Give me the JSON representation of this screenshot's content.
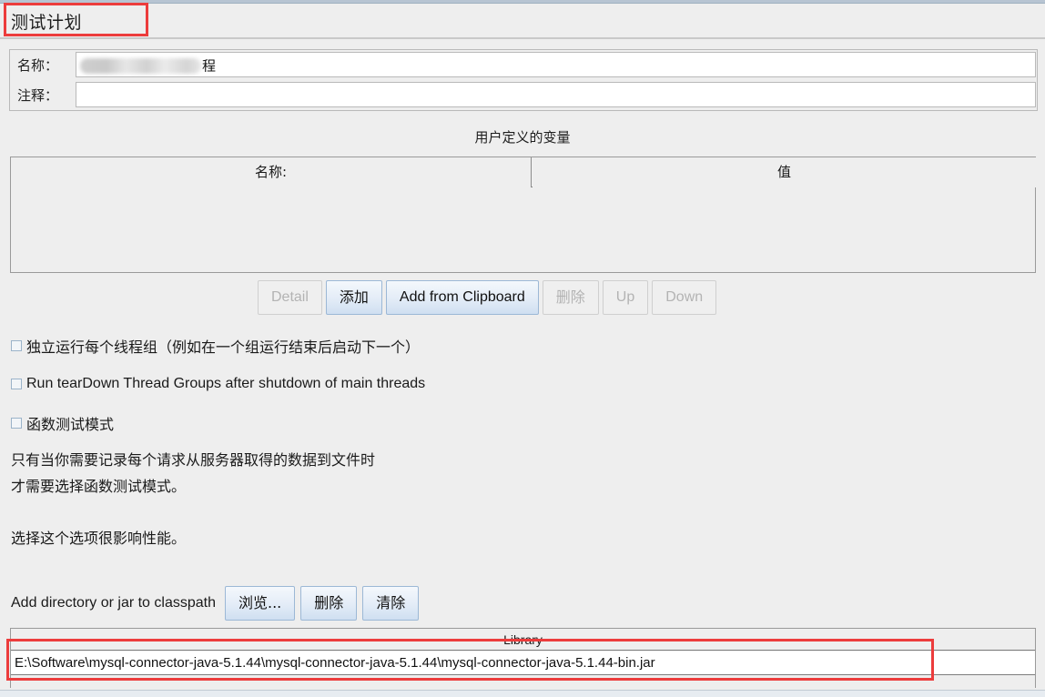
{
  "window": {
    "plan_title": "测试计划"
  },
  "fields": {
    "name_label": "名称：",
    "name_value_tail": "程",
    "name_value_redacted": true,
    "comment_label": "注释：",
    "comment_value": ""
  },
  "user_defined_variables": {
    "caption": "用户定义的变量",
    "columns": [
      "名称:",
      "值"
    ],
    "rows": []
  },
  "variable_buttons": [
    {
      "label": "Detail",
      "enabled": false,
      "script": "latin"
    },
    {
      "label": "添加",
      "enabled": true,
      "script": "cjk"
    },
    {
      "label": "Add from Clipboard",
      "enabled": true,
      "script": "latin"
    },
    {
      "label": "删除",
      "enabled": false,
      "script": "cjk"
    },
    {
      "label": "Up",
      "enabled": false,
      "script": "latin"
    },
    {
      "label": "Down",
      "enabled": false,
      "script": "latin"
    }
  ],
  "checkboxes": [
    {
      "label": "独立运行每个线程组（例如在一个组运行结束后启动下一个）",
      "checked": false,
      "script": "cjk"
    },
    {
      "label": "Run tearDown Thread Groups after shutdown of main threads",
      "checked": false,
      "script": "latin"
    },
    {
      "label": "函数测试模式",
      "checked": false,
      "script": "cjk"
    }
  ],
  "notes": [
    "只有当你需要记录每个请求从服务器取得的数据到文件时",
    "才需要选择函数测试模式。",
    "选择这个选项很影响性能。"
  ],
  "classpath": {
    "label": "Add directory or jar to classpath",
    "buttons": [
      {
        "label": "浏览...",
        "enabled": true,
        "script": "cjk"
      },
      {
        "label": "删除",
        "enabled": true,
        "script": "cjk"
      },
      {
        "label": "清除",
        "enabled": true,
        "script": "cjk"
      }
    ]
  },
  "library_table": {
    "header": "Library",
    "rows": [
      "E:\\Software\\mysql-connector-java-5.1.44\\mysql-connector-java-5.1.44\\mysql-connector-java-5.1.44-bin.jar"
    ]
  },
  "annotations": {
    "accent_color": "#ec3c3c",
    "boxes": [
      "title-highlight",
      "library-highlight"
    ]
  },
  "colors": {
    "background": "#eeeeee",
    "field_background": "#ffffff",
    "border": "#9a9a9a",
    "button_enabled_border": "#9cb8d6",
    "button_disabled_text": "#b3b3b3",
    "annotation_red": "#ec3c3c"
  }
}
